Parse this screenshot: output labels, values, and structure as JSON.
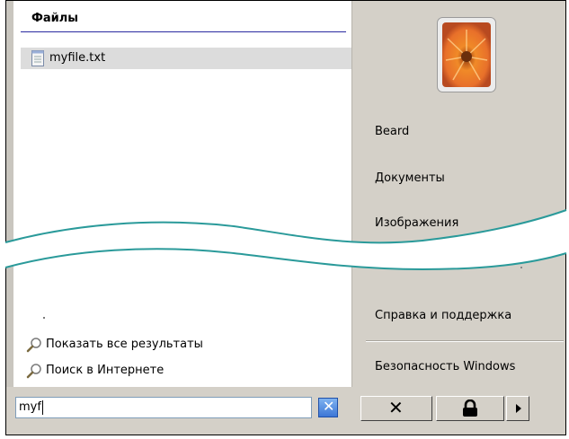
{
  "files_section": {
    "title": "Файлы",
    "items": [
      {
        "name": "myfile.txt",
        "icon": "text-file-icon"
      }
    ]
  },
  "links": {
    "show_all": "Показать все результаты",
    "web_search": "Поиск в Интернете"
  },
  "places": {
    "user": "Beard",
    "documents": "Документы",
    "pictures": "Изображения",
    "help": "Справка и поддержка",
    "security": "Безопасность Windows"
  },
  "search": {
    "value": "myf"
  },
  "buttons": {
    "clear": "✕",
    "shutdown": "✕",
    "lock_icon": "lock-icon",
    "more_icon": "arrow-right-icon"
  },
  "colors": {
    "panel": "#d4d0c8",
    "wave": "#2a9a9a",
    "accent_rule": "#2a2aa0"
  }
}
